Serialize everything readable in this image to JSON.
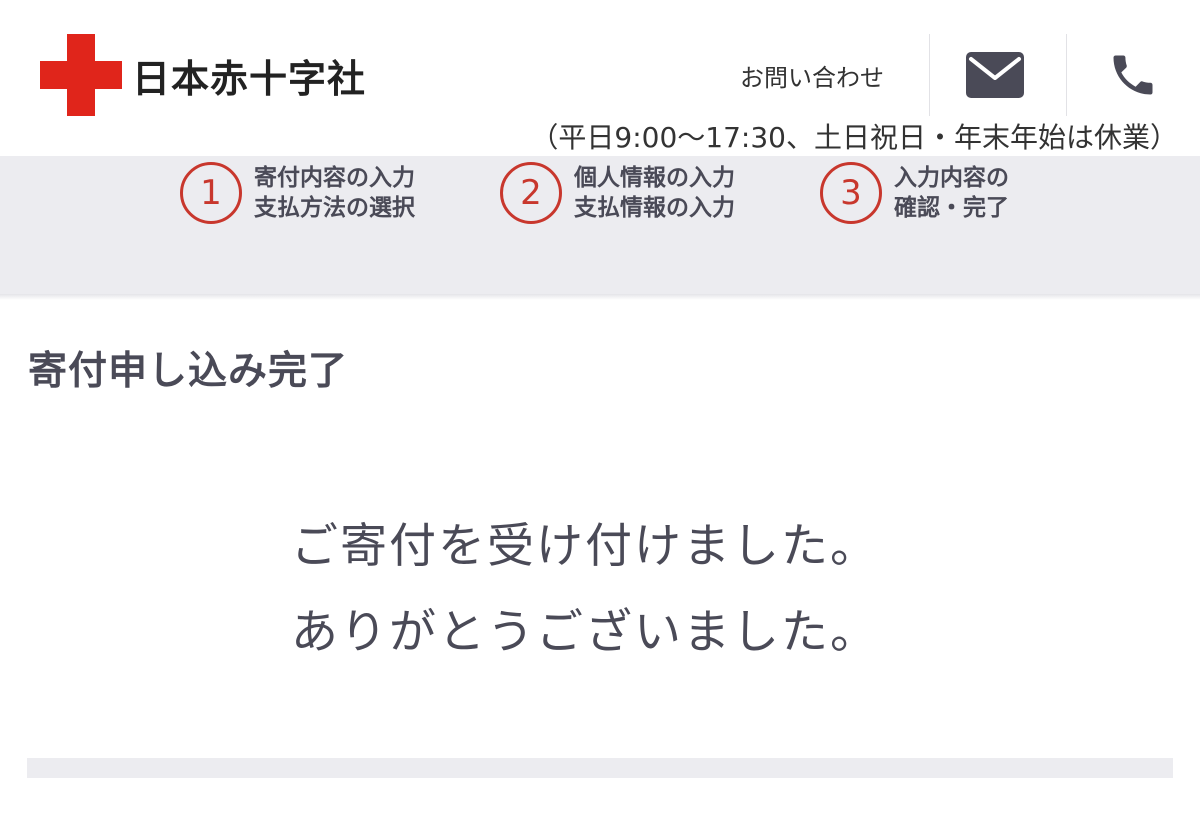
{
  "header": {
    "logo_text": "日本赤十字社",
    "contact_label": "お問い合わせ",
    "mail_icon": "mail-icon",
    "phone_icon": "phone-icon",
    "hours_note": "（平日9:00〜17:30、土日祝日・年末年始は休業）"
  },
  "steps": [
    {
      "number": "1",
      "line1": "寄付内容の入力",
      "line2": "支払方法の選択"
    },
    {
      "number": "2",
      "line1": "個人情報の入力",
      "line2": "支払情報の入力"
    },
    {
      "number": "3",
      "line1": "入力内容の",
      "line2": "確認・完了"
    }
  ],
  "main": {
    "title": "寄付申し込み完了",
    "message_line1": "ご寄付を受け付けました。",
    "message_line2": "ありがとうございました。"
  },
  "colors": {
    "brand_red": "#e0251b",
    "step_red": "#c8372d",
    "text": "#4a4a57",
    "band": "#ececf0"
  }
}
